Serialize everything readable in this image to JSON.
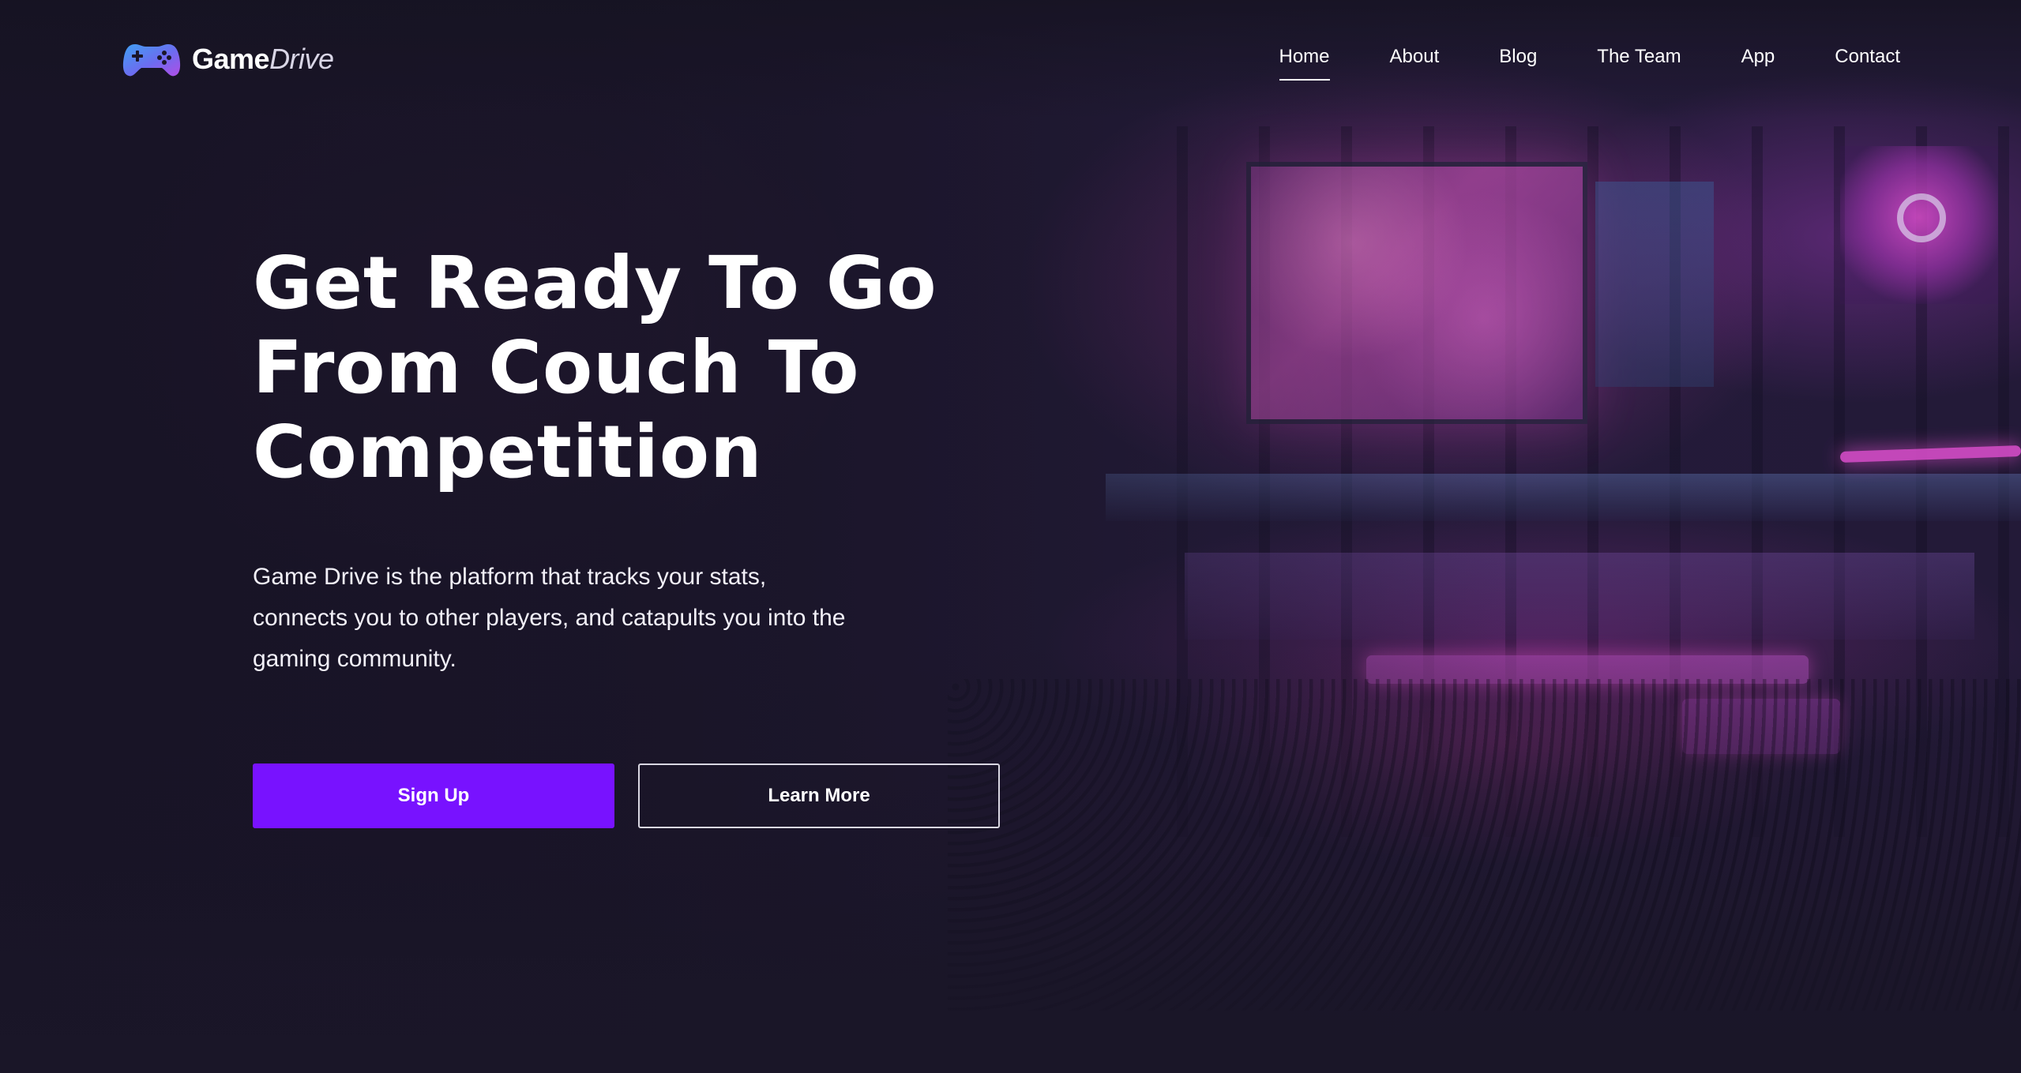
{
  "brand": {
    "name_part1": "Game",
    "name_part2": "Drive",
    "icon": "gamepad-icon",
    "icon_colors": [
      "#3f8ff0",
      "#8a5cf0",
      "#b04ee6"
    ]
  },
  "nav": {
    "items": [
      {
        "label": "Home",
        "active": true
      },
      {
        "label": "About",
        "active": false
      },
      {
        "label": "Blog",
        "active": false
      },
      {
        "label": "The Team",
        "active": false
      },
      {
        "label": "App",
        "active": false
      },
      {
        "label": "Contact",
        "active": false
      }
    ]
  },
  "hero": {
    "title_lines": [
      "Get Ready To Go",
      "From Couch To",
      "Competition"
    ],
    "description_lines": [
      "Game Drive is the platform that tracks your stats,",
      "connects you to other players, and catapults you into the",
      "gaming community."
    ],
    "primary_cta": "Sign Up",
    "secondary_cta": "Learn More"
  },
  "colors": {
    "accent": "#7812ff",
    "background": "#1b1629",
    "neon": "#e04fd0",
    "text": "#ffffff"
  }
}
